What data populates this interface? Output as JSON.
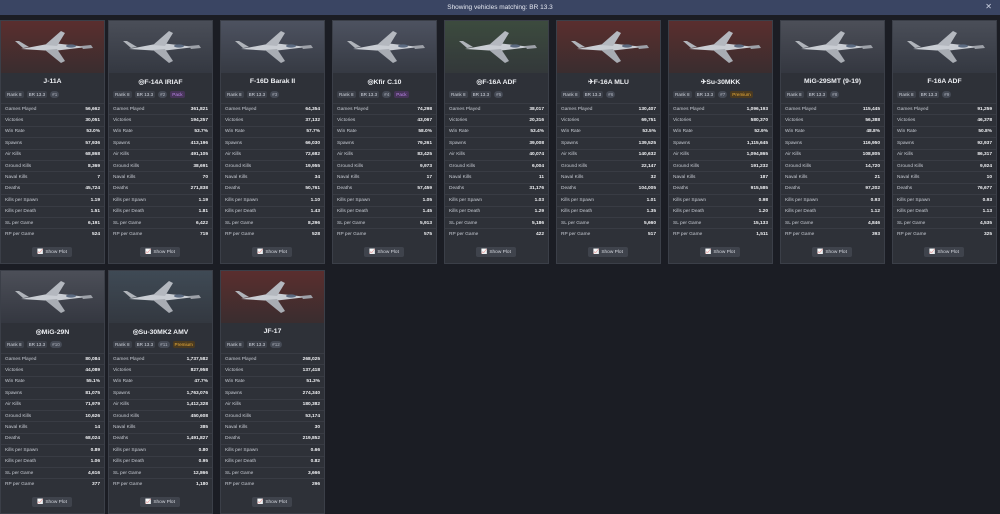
{
  "topbar": {
    "message": "Showing vehicles matching: BR 13.3",
    "close_icon": "✕"
  },
  "labels": {
    "stats": [
      "Games Played",
      "Victories",
      "Win Rate",
      "Spawns",
      "Air Kills",
      "Ground Kills",
      "Naval Kills",
      "Deaths",
      "Kills per Spawn",
      "Kills per Death",
      "SL per Game",
      "RP per Game"
    ],
    "show_plot": "Show Plot"
  },
  "cards": [
    {
      "name": "J-11A",
      "flag": "cn",
      "rank": "Rank 8",
      "br": "BR 13.3",
      "idx": "#1",
      "badge": "",
      "stats": [
        "56,662",
        "30,051",
        "53.0%",
        "57,936",
        "68,868",
        "8,369",
        "7",
        "45,724",
        "1.19",
        "1.51",
        "6,191",
        "524"
      ]
    },
    {
      "name": "◎F-14A IRIAF",
      "flag": "us",
      "rank": "Rank 8",
      "br": "BR 13.3",
      "idx": "#2",
      "badge": "Pack",
      "stats": [
        "361,821",
        "194,257",
        "53.7%",
        "413,196",
        "491,105",
        "38,691",
        "70",
        "271,838",
        "1.19",
        "1.81",
        "6,422",
        "719"
      ]
    },
    {
      "name": "F-16D Barak II",
      "flag": "il",
      "rank": "Rank 8",
      "br": "BR 13.3",
      "idx": "#3",
      "badge": "",
      "stats": [
        "64,354",
        "37,132",
        "57.7%",
        "66,030",
        "72,682",
        "19,955",
        "34",
        "50,761",
        "1.10",
        "1.43",
        "8,296",
        "528"
      ]
    },
    {
      "name": "◎Kfir C.10",
      "flag": "il",
      "rank": "Rank 8",
      "br": "BR 13.3",
      "idx": "#4",
      "badge": "Pack",
      "stats": [
        "74,298",
        "43,067",
        "58.0%",
        "79,261",
        "83,425",
        "9,973",
        "17",
        "57,459",
        "1.05",
        "1.45",
        "5,913",
        "575"
      ]
    },
    {
      "name": "◎F-16A ADF",
      "flag": "ir",
      "rank": "Rank 8",
      "br": "BR 13.3",
      "idx": "#5",
      "badge": "",
      "stats": [
        "38,017",
        "20,316",
        "53.4%",
        "39,008",
        "40,074",
        "6,004",
        "11",
        "31,176",
        "1.03",
        "1.29",
        "5,186",
        "422"
      ]
    },
    {
      "name": "✈F-16A MLU",
      "flag": "cn",
      "rank": "Rank 8",
      "br": "BR 13.3",
      "idx": "#6",
      "badge": "",
      "stats": [
        "130,407",
        "69,751",
        "53.5%",
        "139,525",
        "140,632",
        "22,147",
        "32",
        "104,005",
        "1.01",
        "1.35",
        "5,660",
        "517"
      ]
    },
    {
      "name": "✈Su-30MKK",
      "flag": "cn",
      "rank": "Rank 8",
      "br": "BR 13.3",
      "idx": "#7",
      "badge": "Premium",
      "stats": [
        "1,096,193",
        "580,370",
        "52.9%",
        "1,115,645",
        "1,094,865",
        "191,232",
        "187",
        "915,585",
        "0.98",
        "1.20",
        "15,133",
        "1,511"
      ]
    },
    {
      "name": "MiG-29SMT (9-19)",
      "flag": "ru",
      "rank": "Rank 8",
      "br": "BR 13.3",
      "idx": "#8",
      "badge": "",
      "stats": [
        "115,445",
        "56,388",
        "48.8%",
        "116,950",
        "108,805",
        "14,720",
        "21",
        "97,202",
        "0.93",
        "1.12",
        "4,846",
        "393"
      ]
    },
    {
      "name": "F-16A ADF",
      "flag": "us",
      "rank": "Rank 8",
      "br": "BR 13.3",
      "idx": "#9",
      "badge": "",
      "stats": [
        "91,259",
        "46,378",
        "50.8%",
        "92,937",
        "86,317",
        "9,924",
        "10",
        "76,677",
        "0.93",
        "1.13",
        "4,535",
        "325"
      ]
    },
    {
      "name": "◎MiG-29N",
      "flag": "ru",
      "rank": "Rank 8",
      "br": "BR 13.3",
      "idx": "#10",
      "badge": "",
      "stats": [
        "80,084",
        "44,089",
        "55.1%",
        "81,075",
        "71,979",
        "10,626",
        "14",
        "68,024",
        "0.89",
        "1.06",
        "4,616",
        "377"
      ]
    },
    {
      "name": "◎Su-30MK2 AMV",
      "flag": "gr",
      "rank": "Rank 8",
      "br": "BR 13.3",
      "idx": "#11",
      "badge": "Premium",
      "stats": [
        "1,737,582",
        "827,958",
        "47.7%",
        "1,763,076",
        "1,412,328",
        "450,608",
        "385",
        "1,491,827",
        "0.80",
        "0.95",
        "12,866",
        "1,180"
      ]
    },
    {
      "name": "JF-17",
      "flag": "cn",
      "rank": "Rank 8",
      "br": "BR 13.3",
      "idx": "#12",
      "badge": "",
      "stats": [
        "268,025",
        "137,418",
        "51.3%",
        "274,340",
        "180,382",
        "53,174",
        "30",
        "219,852",
        "0.66",
        "0.82",
        "3,666",
        "296"
      ]
    }
  ]
}
